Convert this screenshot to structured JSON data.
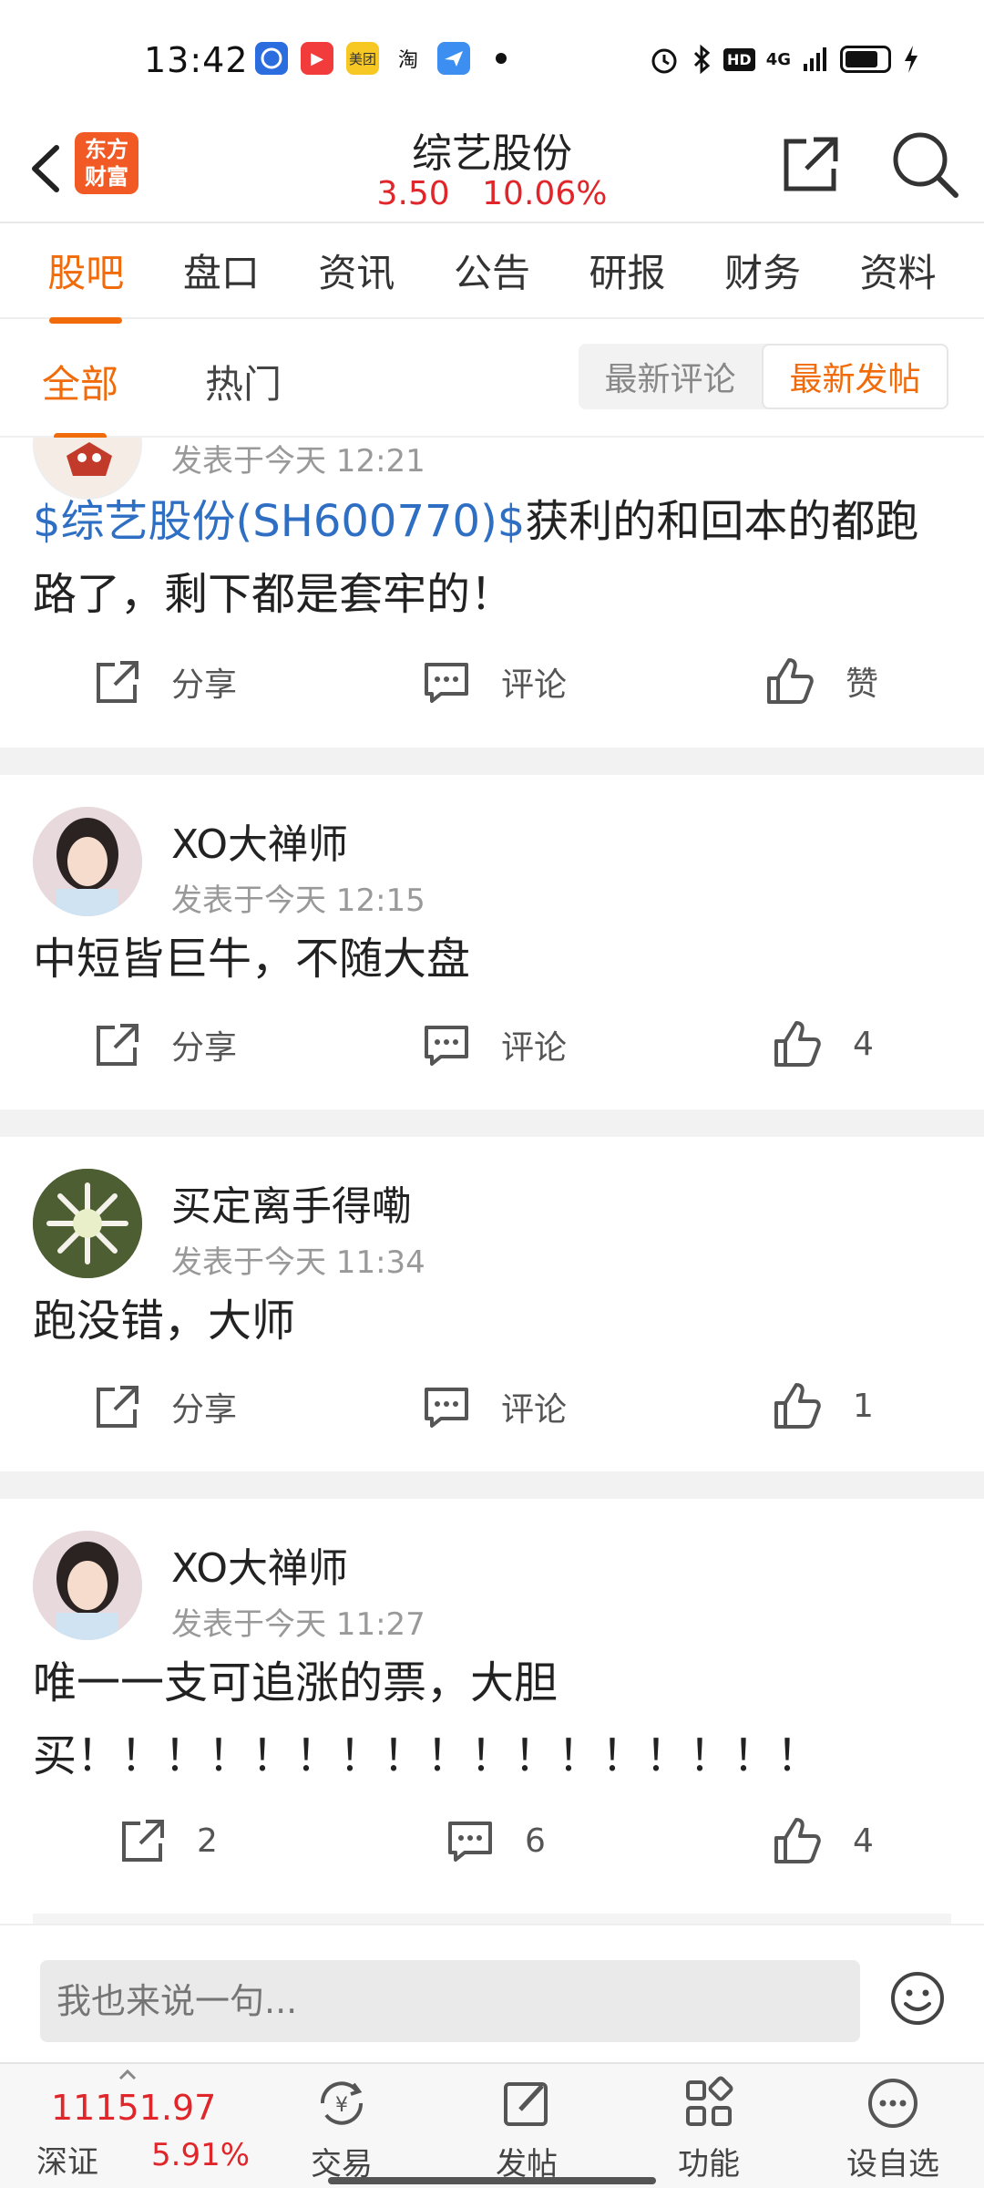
{
  "status_bar": {
    "time": "13:42",
    "apps": [
      {
        "icon": "baidu-icon",
        "label": "",
        "color": "#2b6cde"
      },
      {
        "icon": "video-icon",
        "label": "▶",
        "color": "#f23c3c"
      },
      {
        "icon": "meituan-icon",
        "label": "美团",
        "color": "#f7c823"
      },
      {
        "icon": "taobao-icon",
        "label": "淘",
        "color": "#ff6a00"
      },
      {
        "icon": "plane-icon",
        "label": "",
        "color": "#3c8ff0"
      }
    ],
    "network": "4G"
  },
  "header": {
    "logo_text_line1": "东方",
    "logo_text_line2": "财富",
    "title": "综艺股份",
    "price": "3.50",
    "change_pct": "10.06%"
  },
  "tabs": [
    "股吧",
    "盘口",
    "资讯",
    "公告",
    "研报",
    "财务",
    "资料"
  ],
  "subtabs": {
    "all": "全部",
    "hot": "热门"
  },
  "sort": {
    "latest_comment": "最新评论",
    "latest_post": "最新发帖"
  },
  "posts": [
    {
      "author": "",
      "time": "发表于今天 12:21",
      "stock_link": "$综艺股份(SH600770)$",
      "content_line1": "获利的和回本的都跑",
      "content_line2": "路了，剩下都是套牢的！",
      "share": "分享",
      "comment": "评论",
      "like": "赞"
    },
    {
      "author": "XO大禅师",
      "time": "发表于今天 12:15",
      "content": "中短皆巨牛，不随大盘",
      "share": "分享",
      "comment": "评论",
      "like": "4"
    },
    {
      "author": "买定离手得嘞",
      "time": "发表于今天 11:34",
      "content": "跑没错，大师",
      "share": "分享",
      "comment": "评论",
      "like": "1"
    },
    {
      "author": "XO大禅师",
      "time": "发表于今天 11:27",
      "content_line1": "唯一一支可追涨的票，大胆",
      "content_line2": "买！！！！！！！！！！！！！！！！！",
      "share": "2",
      "comment": "6",
      "like": "4"
    }
  ],
  "input": {
    "placeholder": "我也来说一句..."
  },
  "bottom_nav": {
    "index_value": "11151.97",
    "index_name": "深证",
    "index_change": "5.91%",
    "trade": "交易",
    "post": "发帖",
    "features": "功能",
    "watchlist": "设自选"
  },
  "colors": {
    "accent": "#f16b0a",
    "up": "#e0262a",
    "link": "#2e6fc4"
  }
}
